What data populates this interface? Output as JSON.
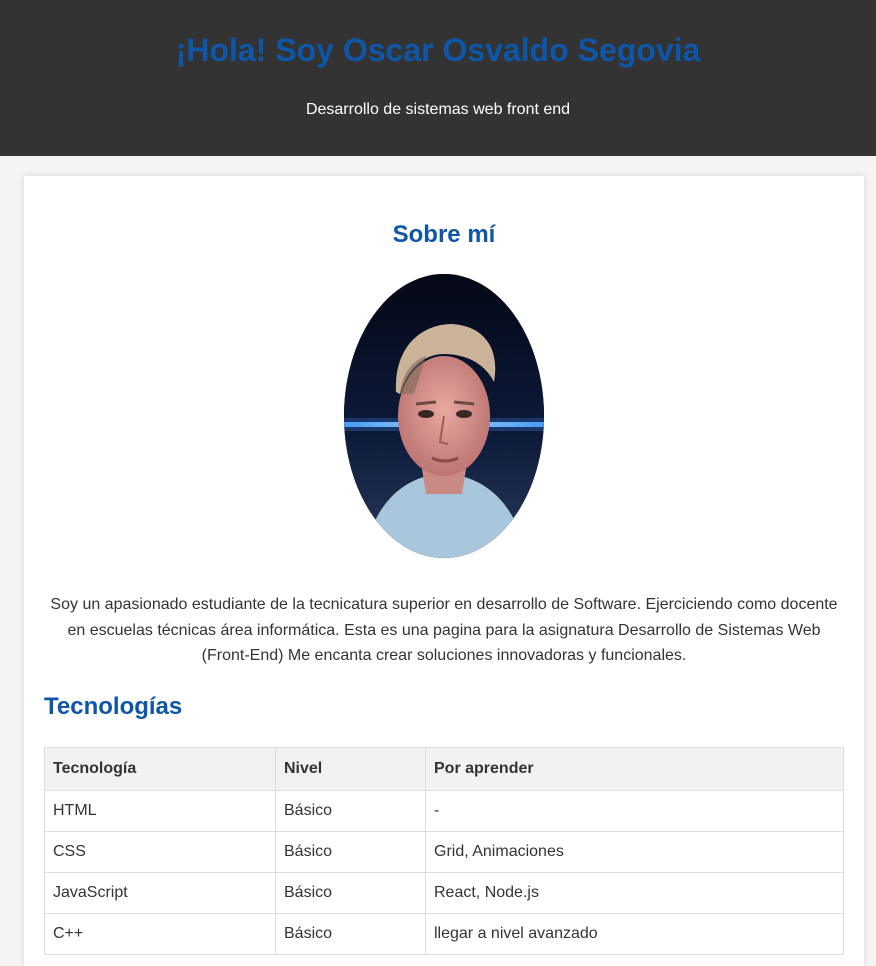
{
  "header": {
    "title": "¡Hola! Soy Oscar Osvaldo Segovia",
    "subtitle": "Desarrollo de sistemas web front end"
  },
  "about": {
    "title": "Sobre mí",
    "photo_icon": "profile-photo",
    "text": "Soy un apasionado estudiante de la tecnicatura superior en desarrollo de Software. Ejerciciendo como docente en escuelas técnicas área informática. Esta es una pagina para la asignatura Desarrollo de Sistemas Web (Front-End) Me encanta crear soluciones innovadoras y funcionales."
  },
  "tech": {
    "title": "Tecnologías",
    "headers": [
      "Tecnología",
      "Nivel",
      "Por aprender"
    ],
    "rows": [
      [
        "HTML",
        "Básico",
        "-"
      ],
      [
        "CSS",
        "Básico",
        "Grid, Animaciones"
      ],
      [
        "JavaScript",
        "Básico",
        "React, Node.js"
      ],
      [
        "C++",
        "Básico",
        "llegar a nivel avanzado"
      ]
    ]
  },
  "colors": {
    "header_bg": "#333333",
    "accent": "#0e56a8",
    "page_bg": "#f4f4f4"
  }
}
